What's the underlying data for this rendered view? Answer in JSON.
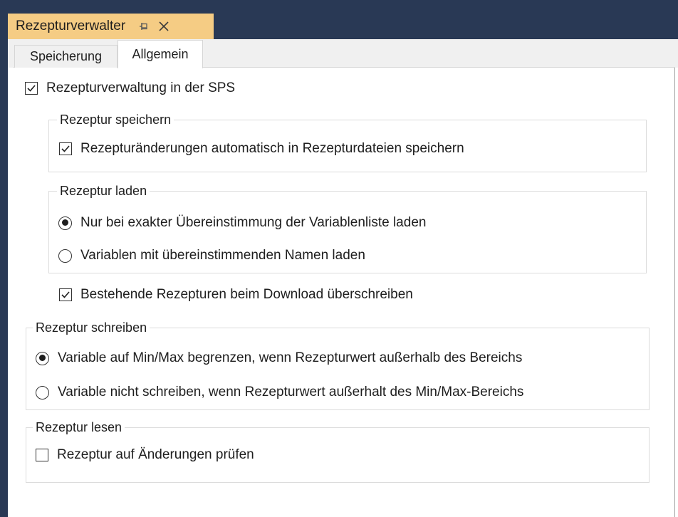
{
  "window": {
    "title": "Rezepturverwalter",
    "pin_icon": "pin-icon",
    "close_icon": "close-icon",
    "accent_color": "#f5cc84",
    "frame_color": "#293955"
  },
  "tabs": [
    {
      "label": "Speicherung",
      "selected": false
    },
    {
      "label": "Allgemein",
      "selected": true
    }
  ],
  "main_checkbox": {
    "label": "Rezepturverwaltung in der SPS",
    "checked": true
  },
  "group_save": {
    "legend": "Rezeptur speichern",
    "checkbox": {
      "label": "Rezepturänderungen automatisch in Rezepturdateien speichern",
      "checked": true
    }
  },
  "group_load": {
    "legend": "Rezeptur laden",
    "options": [
      {
        "label": "Nur bei exakter Übereinstimmung der Variablenliste laden",
        "selected": true
      },
      {
        "label": "Variablen mit übereinstimmenden Namen laden",
        "selected": false
      }
    ]
  },
  "overwrite_checkbox": {
    "label": "Bestehende Rezepturen beim Download überschreiben",
    "checked": true
  },
  "group_write": {
    "legend": "Rezeptur schreiben",
    "options": [
      {
        "label": "Variable auf Min/Max begrenzen, wenn Rezepturwert außerhalb des Bereichs",
        "selected": true
      },
      {
        "label": "Variable nicht schreiben, wenn Rezepturwert außerhalt des Min/Max-Bereichs",
        "selected": false
      }
    ]
  },
  "group_read": {
    "legend": "Rezeptur lesen",
    "checkbox": {
      "label": "Rezeptur auf Änderungen prüfen",
      "checked": false
    }
  }
}
